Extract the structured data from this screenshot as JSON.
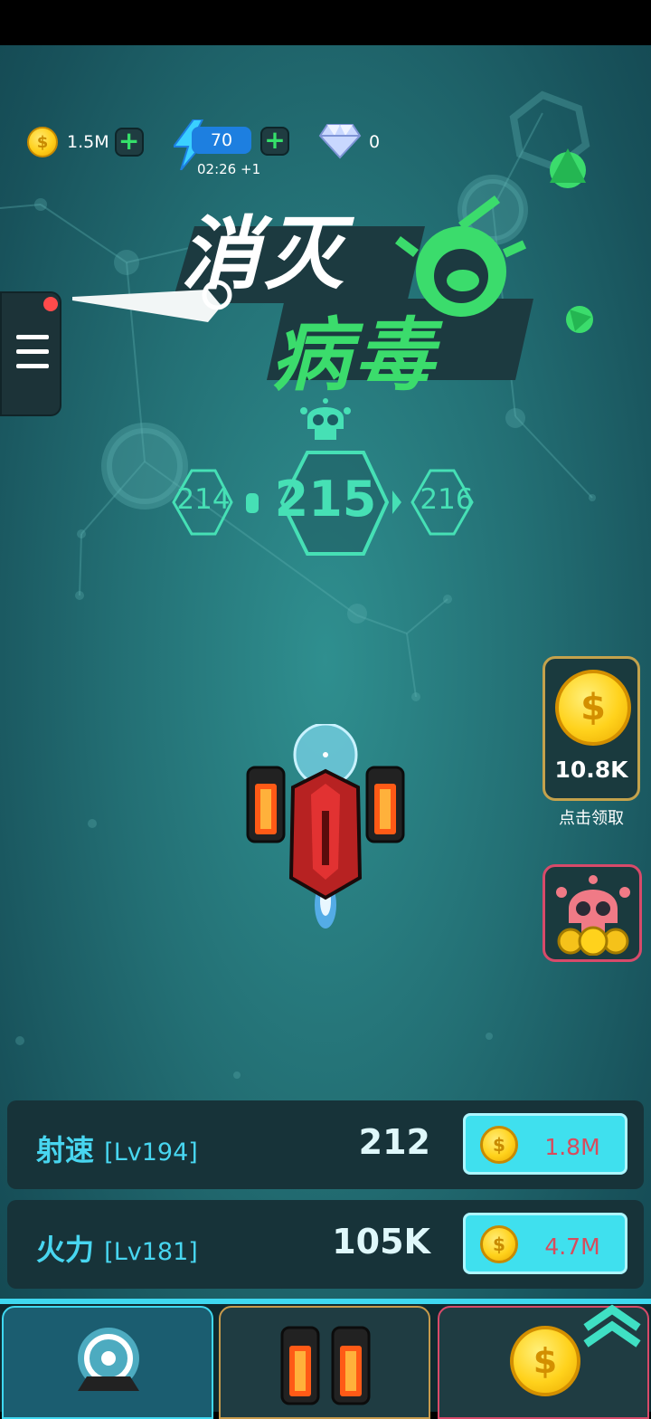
{
  "resources": {
    "coins": "1.5M",
    "energy": "70",
    "energy_timer": "02:26 +1",
    "gems": "0"
  },
  "title": {
    "line1": "消灭",
    "line2": "病毒"
  },
  "levels": {
    "prev": "214",
    "current": "215",
    "next": "216"
  },
  "reward": {
    "amount": "10.8K",
    "label": "点击领取"
  },
  "upgrades": [
    {
      "name": "射速",
      "level": "[Lv194]",
      "value": "212",
      "cost": "1.8M"
    },
    {
      "name": "火力",
      "level": "[Lv181]",
      "value": "105K",
      "cost": "4.7M"
    }
  ],
  "colors": {
    "accent": "#46e0b5",
    "upgrade_text": "#48d6f0",
    "upgrade_button": "#3fe0ee",
    "cost_text": "#d84b5c",
    "coin": "#ffd21c"
  },
  "icons": {
    "coin": "coin-icon",
    "energy": "lightning-icon",
    "gem": "diamond-icon",
    "add": "plus-icon",
    "menu": "hamburger-icon"
  }
}
